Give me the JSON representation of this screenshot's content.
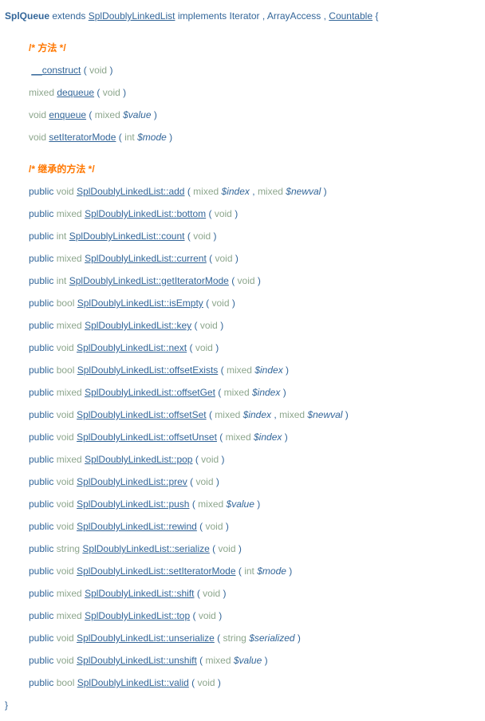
{
  "header": {
    "class": "SplQueue",
    "extends_kw": "extends",
    "parent": "SplDoublyLinkedList",
    "implements_kw": "implements",
    "iface1": "Iterator",
    "iface2": "ArrayAccess",
    "iface3": "Countable",
    "open": "{",
    "close": "}",
    "comma": ",",
    "lp": "(",
    "rp": ")"
  },
  "sec": {
    "methods": "/* 方法 */",
    "inherited": "/* 继承的方法 */"
  },
  "m": {
    "construct": "__construct",
    "dequeue": "dequeue",
    "enqueue": "enqueue",
    "setIteratorMode": "setIteratorMode"
  },
  "t": {
    "void": "void",
    "mixed": "mixed",
    "int": "int",
    "bool": "bool",
    "string": "string",
    "public": "public"
  },
  "p": {
    "value": "$value",
    "mode": "$mode",
    "index": "$index",
    "newval": "$newval",
    "serialized": "$serialized"
  },
  "inh": {
    "add": "SplDoublyLinkedList::add",
    "bottom": "SplDoublyLinkedList::bottom",
    "count": "SplDoublyLinkedList::count",
    "current": "SplDoublyLinkedList::current",
    "getIteratorMode": "SplDoublyLinkedList::getIteratorMode",
    "isEmpty": "SplDoublyLinkedList::isEmpty",
    "key": "SplDoublyLinkedList::key",
    "next": "SplDoublyLinkedList::next",
    "offsetExists": "SplDoublyLinkedList::offsetExists",
    "offsetGet": "SplDoublyLinkedList::offsetGet",
    "offsetSet": "SplDoublyLinkedList::offsetSet",
    "offsetUnset": "SplDoublyLinkedList::offsetUnset",
    "pop": "SplDoublyLinkedList::pop",
    "prev": "SplDoublyLinkedList::prev",
    "push": "SplDoublyLinkedList::push",
    "rewind": "SplDoublyLinkedList::rewind",
    "serialize": "SplDoublyLinkedList::serialize",
    "setIteratorMode": "SplDoublyLinkedList::setIteratorMode",
    "shift": "SplDoublyLinkedList::shift",
    "top": "SplDoublyLinkedList::top",
    "unserialize": "SplDoublyLinkedList::unserialize",
    "unshift": "SplDoublyLinkedList::unshift",
    "valid": "SplDoublyLinkedList::valid"
  }
}
